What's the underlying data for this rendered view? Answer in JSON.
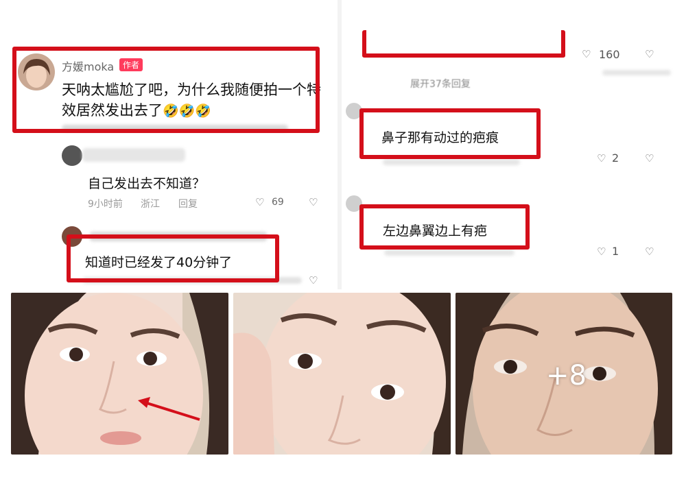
{
  "left_comments": {
    "author": {
      "username": "方媛moka",
      "author_badge": "作者",
      "text_line1": "天呐太尴尬了吧，为什么我随便拍一个特",
      "text_line2": "效居然发出去了",
      "emojis": "🤣🤣🤣"
    },
    "reply1": {
      "text": "自己发出去不知道？",
      "time": "9小时前",
      "location": "浙江",
      "reply_label": "回复",
      "like_count": "69"
    },
    "reply2": {
      "text": "知道时已经发了40分钟了"
    }
  },
  "right_comments": {
    "top": {
      "like_count": "160",
      "expand_label": "展开37条回复"
    },
    "c1": {
      "text": "鼻子那有动过的疤痕",
      "like_count": "2"
    },
    "c2": {
      "text": "左边鼻翼边上有疤",
      "like_count": "1"
    }
  },
  "gallery": {
    "more_count": "+8"
  },
  "icons": {
    "heart": "heart-outline-icon",
    "broken_heart": "broken-heart-icon",
    "arrow": "red-arrow-icon"
  },
  "colors": {
    "highlight_red": "#d40f1a",
    "author_badge_bg": "#ff3b5c",
    "muted_text": "#999999"
  }
}
